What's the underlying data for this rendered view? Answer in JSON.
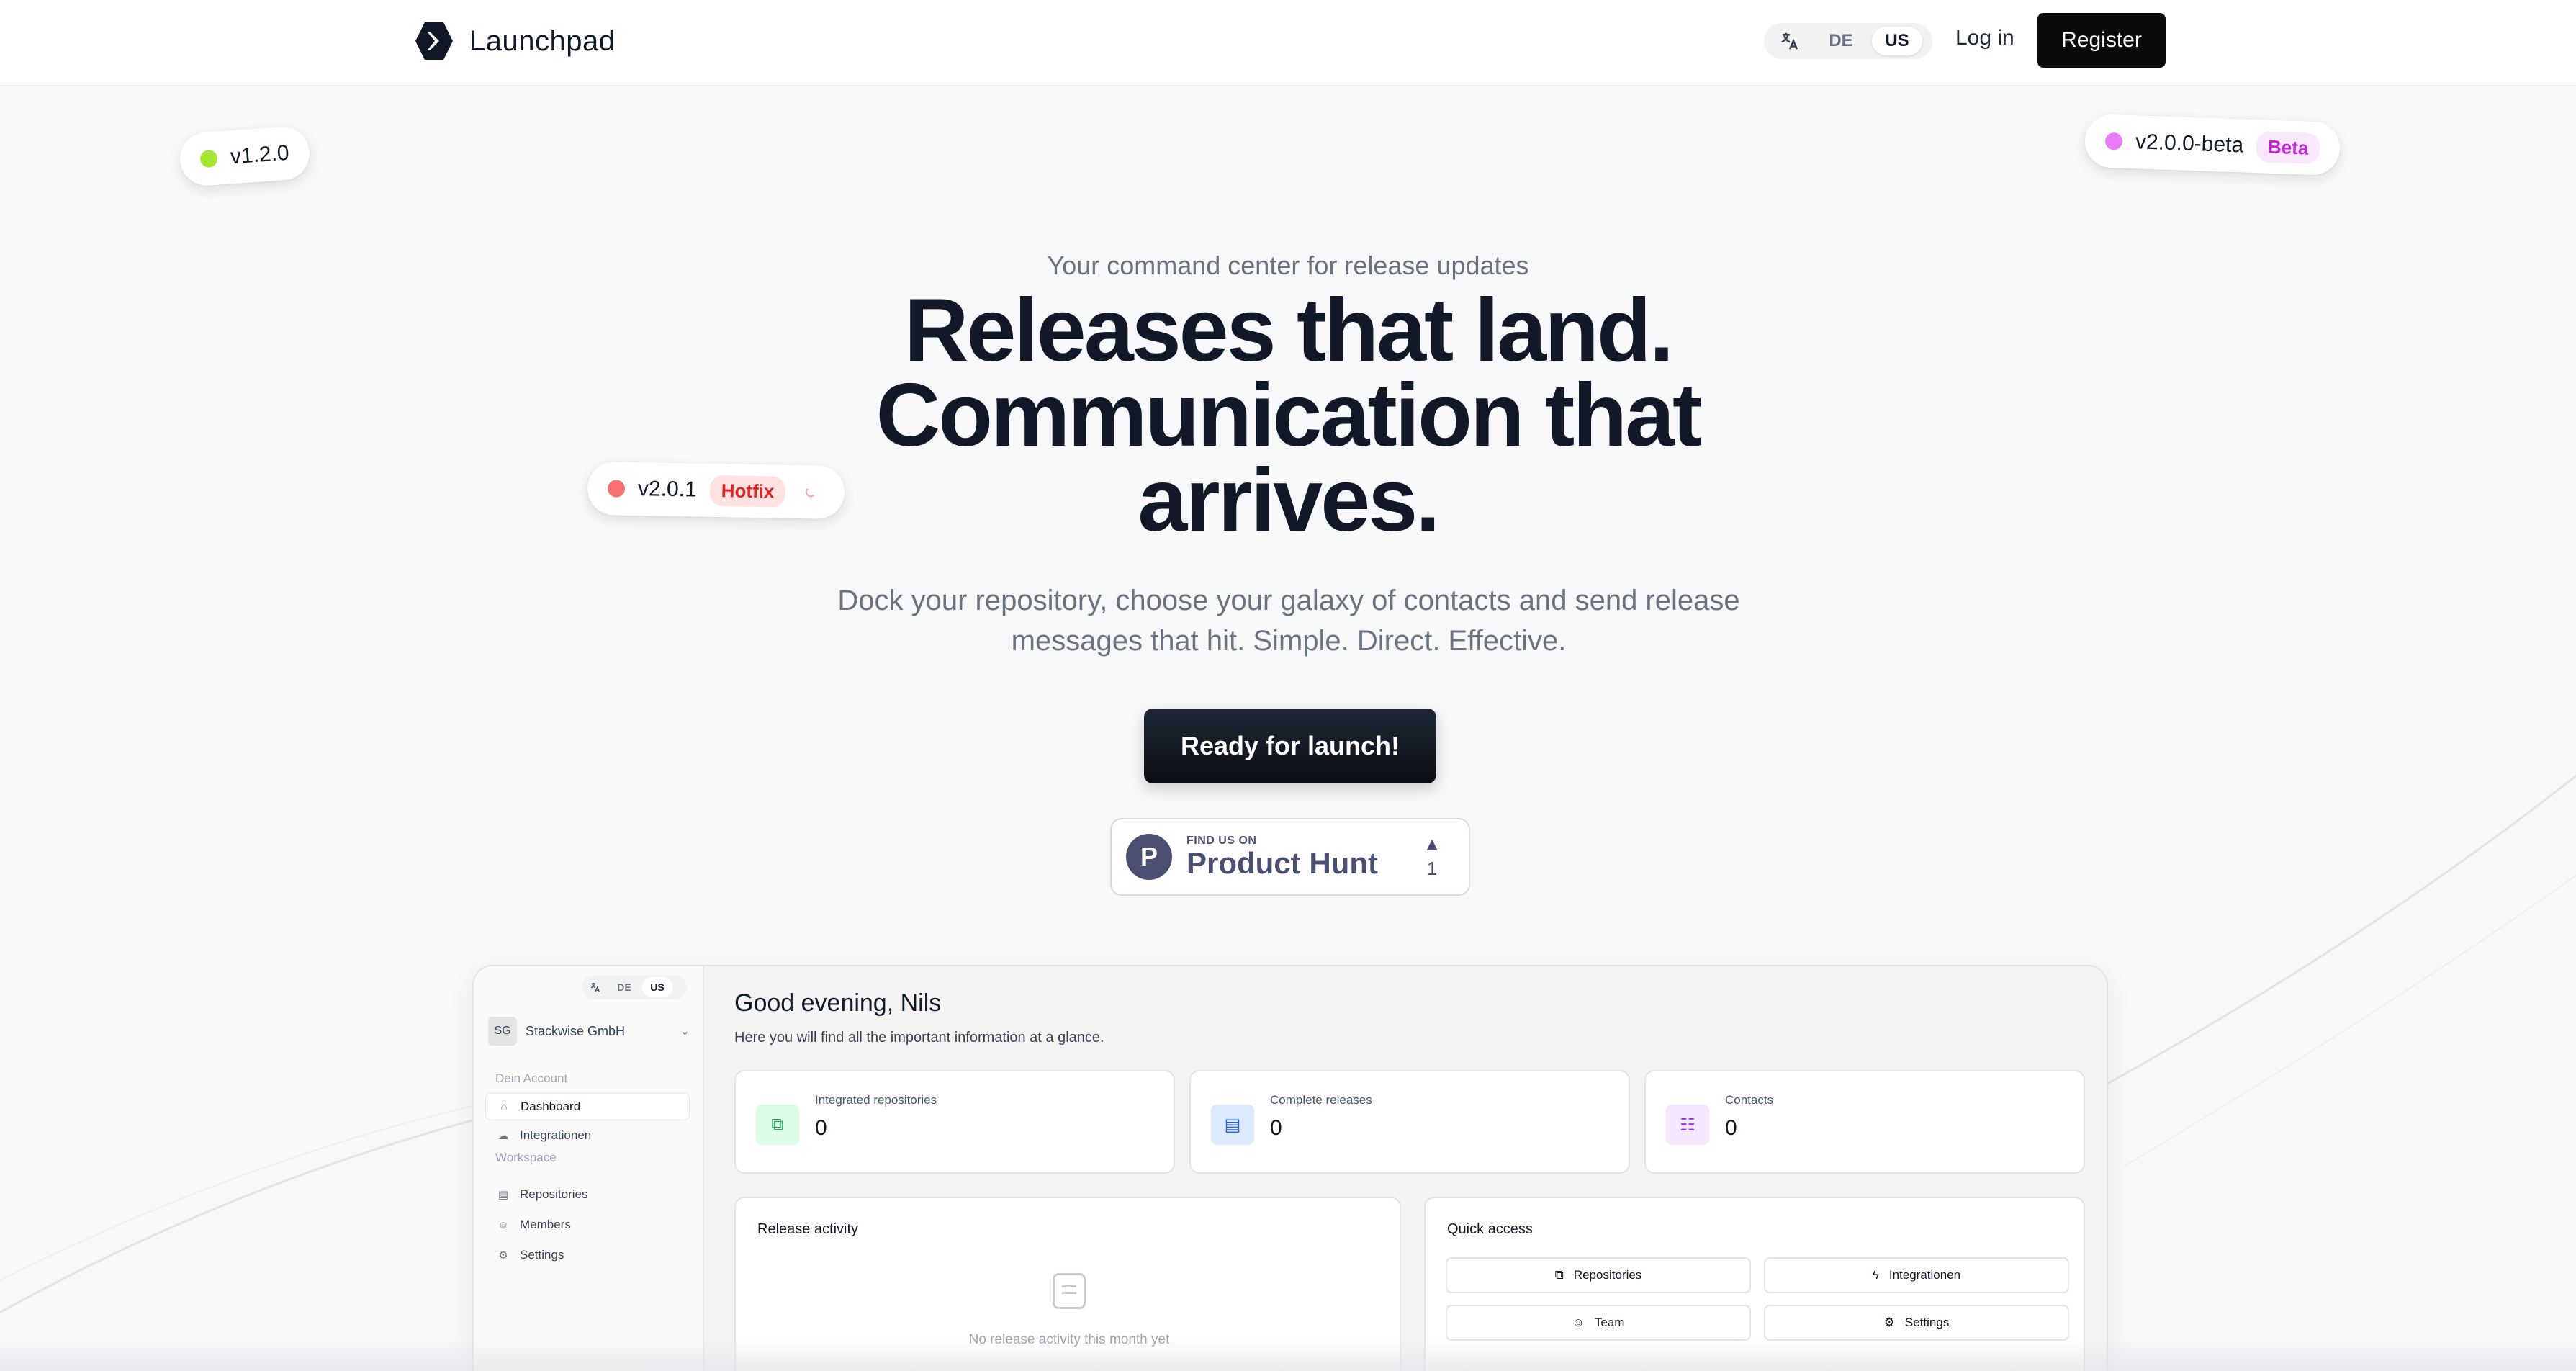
{
  "nav": {
    "brand": "Launchpad",
    "lang_options": [
      "DE",
      "US"
    ],
    "lang_active": "US",
    "login": "Log in",
    "register": "Register"
  },
  "pills": {
    "v120": {
      "label": "v1.2.0",
      "color": "#a3e635"
    },
    "v200beta": {
      "label": "v2.0.0-beta",
      "tag": "Beta",
      "color": "#e879f9"
    },
    "v201": {
      "label": "v2.0.1",
      "tag": "Hotfix",
      "color": "#f87171"
    }
  },
  "hero": {
    "eyebrow": "Your command center for release updates",
    "title_line1": "Releases that land.",
    "title_line2": "Communication that",
    "title_line3": "arrives.",
    "subtitle": "Dock your repository, choose your galaxy of contacts and send release messages that hit. Simple. Direct. Effective.",
    "cta": "Ready for launch!"
  },
  "product_hunt": {
    "small": "FIND US ON",
    "big": "Product Hunt",
    "letter": "P",
    "votes": "1"
  },
  "preview": {
    "lang_options": [
      "DE",
      "US"
    ],
    "org_initials": "SG",
    "org_name": "Stackwise GmbH",
    "section_account": "Dein Account",
    "section_workspace": "Workspace",
    "nav_dashboard": "Dashboard",
    "nav_integrations": "Integrationen",
    "nav_repositories": "Repositories",
    "nav_members": "Members",
    "nav_settings": "Settings",
    "greeting": "Good evening, Nils",
    "greeting_sub": "Here you will find all the important information at a glance.",
    "cards": [
      {
        "label": "Integrated repositories",
        "value": "0"
      },
      {
        "label": "Complete releases",
        "value": "0"
      },
      {
        "label": "Contacts",
        "value": "0"
      }
    ],
    "release_activity_title": "Release activity",
    "release_activity_empty": "No release activity this month yet",
    "quick_access_title": "Quick access",
    "quick_access": [
      "Repositories",
      "Integrationen",
      "Team",
      "Settings"
    ]
  }
}
